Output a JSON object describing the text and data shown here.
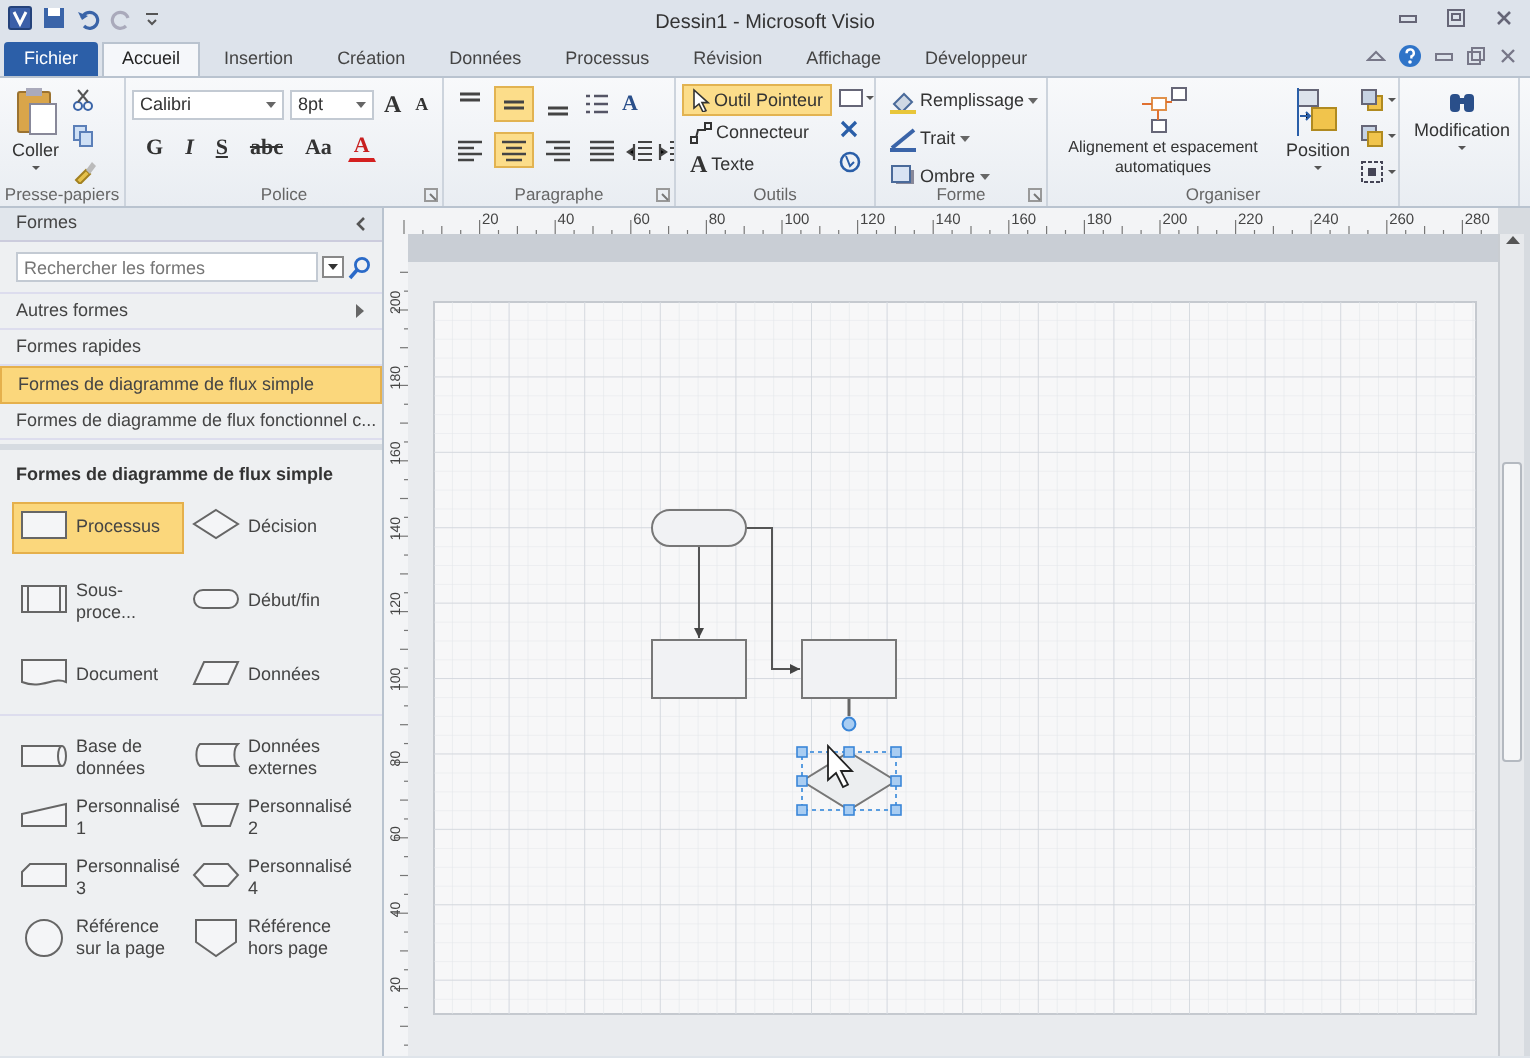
{
  "window": {
    "title": "Dessin1 - Microsoft Visio"
  },
  "tabs": [
    {
      "label": "Fichier",
      "kind": "file",
      "selected": false
    },
    {
      "label": "Accueil",
      "kind": "tab",
      "selected": true
    },
    {
      "label": "Insertion",
      "kind": "tab",
      "selected": false
    },
    {
      "label": "Création",
      "kind": "tab",
      "selected": false
    },
    {
      "label": "Données",
      "kind": "tab",
      "selected": false
    },
    {
      "label": "Processus",
      "kind": "tab",
      "selected": false
    },
    {
      "label": "Révision",
      "kind": "tab",
      "selected": false
    },
    {
      "label": "Affichage",
      "kind": "tab",
      "selected": false
    },
    {
      "label": "Développeur",
      "kind": "tab",
      "selected": false
    }
  ],
  "ribbon": {
    "clipboard": {
      "title": "Presse-papiers",
      "paste": "Coller"
    },
    "font": {
      "title": "Police",
      "name": "Calibri",
      "size": "8pt",
      "size_buttons": [
        "A",
        "A"
      ],
      "styles": [
        "G",
        "I",
        "S",
        "abc",
        "Aa"
      ],
      "font_color": "A"
    },
    "paragraph": {
      "title": "Paragraphe",
      "vertical_align": [
        {
          "selected": false
        },
        {
          "selected": true
        },
        {
          "selected": false
        }
      ],
      "horizontal_align": [
        {
          "selected": false
        },
        {
          "selected": true
        },
        {
          "selected": false
        },
        {
          "selected": false
        }
      ],
      "text_style": "A"
    },
    "tools": {
      "title": "Outils",
      "items": [
        {
          "label": "Outil Pointeur",
          "kind": "pointer",
          "selected": true
        },
        {
          "label": "Connecteur",
          "kind": "connector",
          "selected": false
        },
        {
          "label": "Texte",
          "kind": "text",
          "icon_text": "A",
          "selected": false
        }
      ]
    },
    "shape": {
      "title": "Forme",
      "items": [
        {
          "label": "Remplissage",
          "kind": "fill"
        },
        {
          "label": "Trait",
          "kind": "line"
        },
        {
          "label": "Ombre",
          "kind": "shadow"
        }
      ]
    },
    "arrange": {
      "title": "Organiser",
      "auto_align": "Alignement et espacement automatiques",
      "position": "Position"
    },
    "editing": {
      "label": "Modification"
    }
  },
  "shapes_panel": {
    "title": "Formes",
    "search": {
      "placeholder": "Rechercher les formes"
    },
    "more": "Autres formes",
    "stencils": [
      {
        "label": "Formes rapides",
        "selected": false
      },
      {
        "label": "Formes de diagramme de flux simple",
        "selected": true
      },
      {
        "label": "Formes de diagramme de flux fonctionnel c...",
        "selected": false
      }
    ],
    "section_title": "Formes de diagramme de flux simple",
    "shape_groups": [
      [
        {
          "label": "Processus",
          "kind": "process",
          "selected": true
        },
        {
          "label": "Décision",
          "kind": "decision",
          "selected": false
        },
        {
          "label": "Sous-proce...",
          "kind": "subprocess",
          "selected": false
        },
        {
          "label": "Début/fin",
          "kind": "terminator",
          "selected": false
        },
        {
          "label": "Document",
          "kind": "document",
          "selected": false
        },
        {
          "label": "Données",
          "kind": "data",
          "selected": false
        }
      ],
      [
        {
          "label": "Base de données",
          "kind": "database",
          "selected": false
        },
        {
          "label": "Données externes",
          "kind": "external",
          "selected": false
        },
        {
          "label": "Personnalisé 1",
          "kind": "custom1",
          "selected": false
        },
        {
          "label": "Personnalisé 2",
          "kind": "custom2",
          "selected": false
        },
        {
          "label": "Personnalisé 3",
          "kind": "custom3",
          "selected": false
        },
        {
          "label": "Personnalisé 4",
          "kind": "custom4",
          "selected": false
        },
        {
          "label": "Référence sur la page",
          "kind": "onpage",
          "selected": false
        },
        {
          "label": "Référence hors page",
          "kind": "offpage",
          "selected": false
        }
      ]
    ]
  },
  "ruler": {
    "horizontal": [
      "20",
      "40",
      "60",
      "80",
      "100",
      "120",
      "140",
      "160",
      "180",
      "200",
      "220",
      "240",
      "260",
      "280"
    ],
    "vertical": [
      "200",
      "180",
      "160",
      "140",
      "120",
      "100",
      "80",
      "60",
      "40",
      "20"
    ]
  },
  "diagram": {
    "shapes": [
      {
        "kind": "terminator",
        "selected": false
      },
      {
        "kind": "process",
        "selected": false
      },
      {
        "kind": "process",
        "selected": false
      },
      {
        "kind": "decision",
        "selected": true
      }
    ]
  }
}
